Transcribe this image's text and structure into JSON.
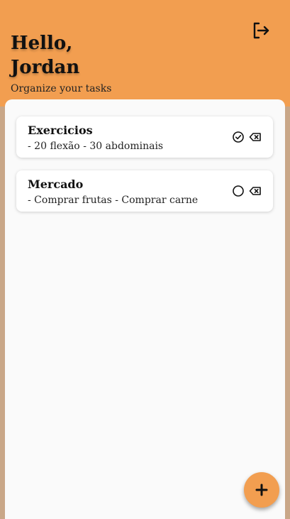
{
  "header": {
    "greeting_line1": "Hello,",
    "greeting_line2": "Jordan",
    "subtitle": "Organize your tasks",
    "logout_icon": "logout-icon"
  },
  "tasks": [
    {
      "title": "Exercicios",
      "description": "- 20 flexão - 30 abdominais",
      "status_icon": "check-circle-icon",
      "completed": true,
      "delete_icon": "backspace-icon"
    },
    {
      "title": "Mercado",
      "description": "- Comprar frutas - Comprar carne",
      "status_icon": "circle-icon",
      "completed": false,
      "delete_icon": "backspace-icon"
    }
  ],
  "fab": {
    "icon": "plus-icon"
  },
  "colors": {
    "accent": "#f29e50",
    "panel": "#fafafa",
    "page_bg": "#c9a788",
    "text": "#111111"
  }
}
